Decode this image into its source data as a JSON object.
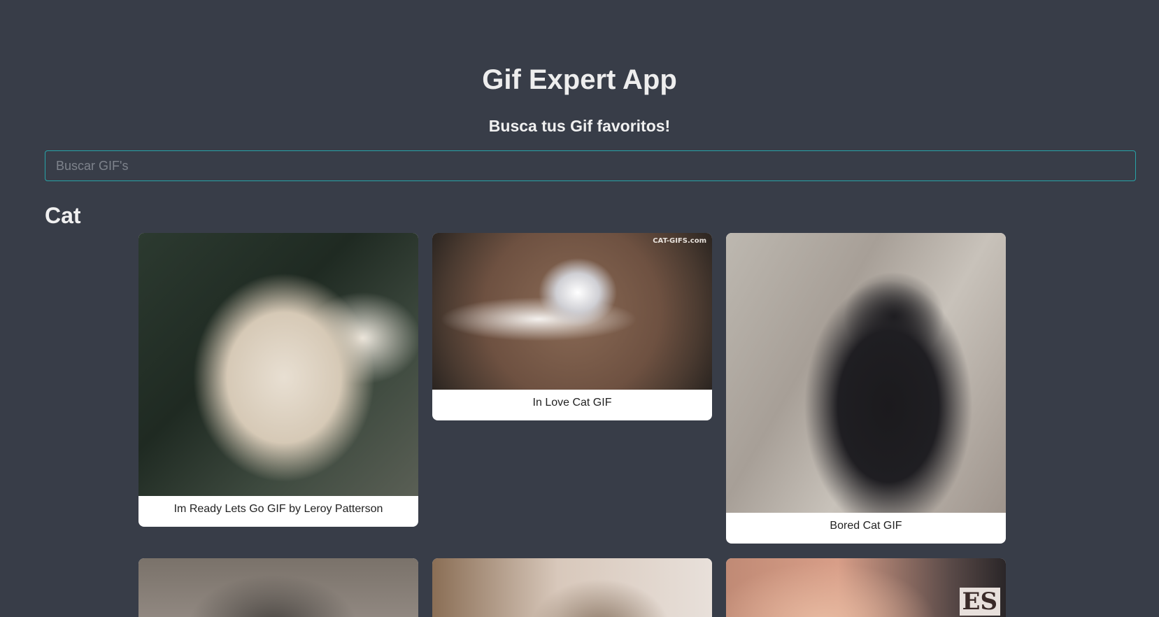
{
  "header": {
    "title": "Gif Expert App",
    "subtitle": "Busca tus Gif favoritos!"
  },
  "search": {
    "placeholder": "Buscar GIF's",
    "value": "",
    "border_color": "#27a3a7"
  },
  "category": {
    "name": "Cat",
    "gifs": [
      {
        "title": "Im Ready Lets Go GIF by Leroy Patterson"
      },
      {
        "title": "In Love Cat GIF",
        "watermark": "CAT-GIFS.com"
      },
      {
        "title": "Bored Cat GIF"
      },
      {
        "title": ""
      },
      {
        "title": ""
      },
      {
        "title": "",
        "image_text": "ES"
      }
    ]
  },
  "colors": {
    "background": "#383d48",
    "card": "#ffffff",
    "accent": "#27a3a7"
  }
}
